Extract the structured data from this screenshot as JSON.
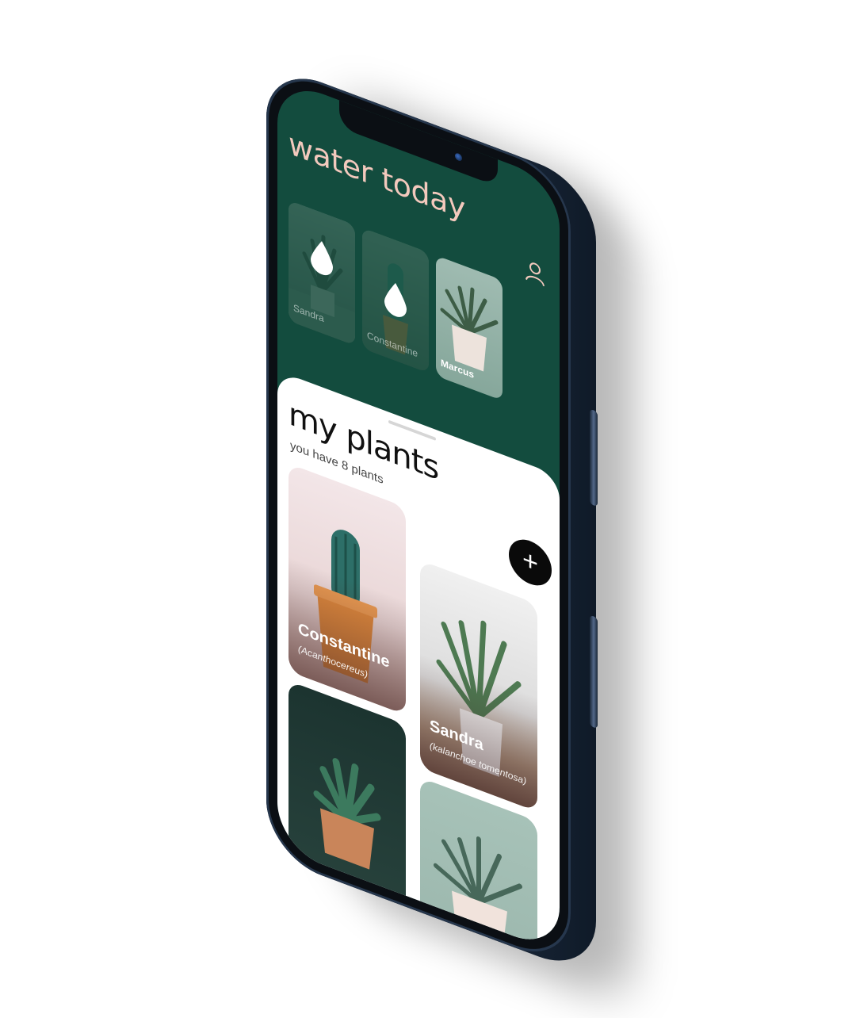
{
  "header": {
    "title": "water today",
    "profile_icon": "person-icon"
  },
  "water_today": [
    {
      "name": "Sandra",
      "watered": false,
      "icon": "water-drop-icon"
    },
    {
      "name": "Constantine",
      "watered": false,
      "icon": "water-drop-icon"
    },
    {
      "name": "Marcus",
      "watered": true
    }
  ],
  "my_plants": {
    "title": "my plants",
    "subtitle": "you have 8 plants",
    "add_label": "+",
    "plants": [
      {
        "name": "Constantine",
        "species": "(Acanthocereus)"
      },
      {
        "name": "Sandra",
        "species": "(kalanchoe tomentosa)"
      },
      {
        "name": "",
        "species": ""
      },
      {
        "name": "",
        "species": ""
      }
    ]
  },
  "colors": {
    "header_bg": "#134c3e",
    "title_color": "#f3c9bd",
    "sheet_bg": "#ffffff",
    "add_button": "#0a0a0a",
    "phone_frame": "#2a3b52"
  }
}
